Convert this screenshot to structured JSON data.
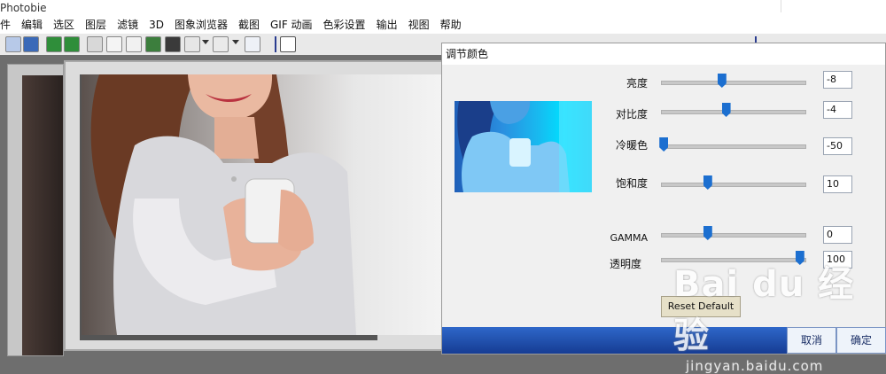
{
  "app": {
    "title": "Photobie"
  },
  "menu": {
    "items": [
      "件",
      "编辑",
      "选区",
      "图层",
      "滤镜",
      "3D",
      "图象浏览器",
      "截图",
      "GIF 动画",
      "色彩设置",
      "输出",
      "视图",
      "帮助"
    ]
  },
  "toolbar": {
    "icons": [
      "monitor-icon",
      "save-icon",
      "undo-icon",
      "redo-icon",
      "grid-icon",
      "copy-icon",
      "doc-icon",
      "cut-icon",
      "paste-icon",
      "clipboard-icon",
      "zoom-in-icon",
      "zoom-out-icon",
      "zoom-icon"
    ]
  },
  "dialog": {
    "title": "调节颜色",
    "rows": [
      {
        "label": "亮度",
        "value": "-8",
        "level": 0.43
      },
      {
        "label": "对比度",
        "value": "-4",
        "level": 0.46
      },
      {
        "label": "冷暖色",
        "value": "-50",
        "level": 0.02
      },
      {
        "label": "饱和度",
        "value": "10",
        "level": 0.33
      },
      {
        "label": "GAMMA",
        "value": "0",
        "level": 0.33
      },
      {
        "label": "透明度",
        "value": "100",
        "level": 0.98
      }
    ],
    "reset_label": "Reset Default",
    "cancel_label": "取消",
    "ok_label": "确定"
  },
  "watermark": {
    "brand": "Bai du 经验",
    "url": "jingyan.baidu.com"
  },
  "colors": {
    "accent": "#1c6fd0",
    "footer": "#1f4fb0",
    "preview": "#19b8ef"
  }
}
